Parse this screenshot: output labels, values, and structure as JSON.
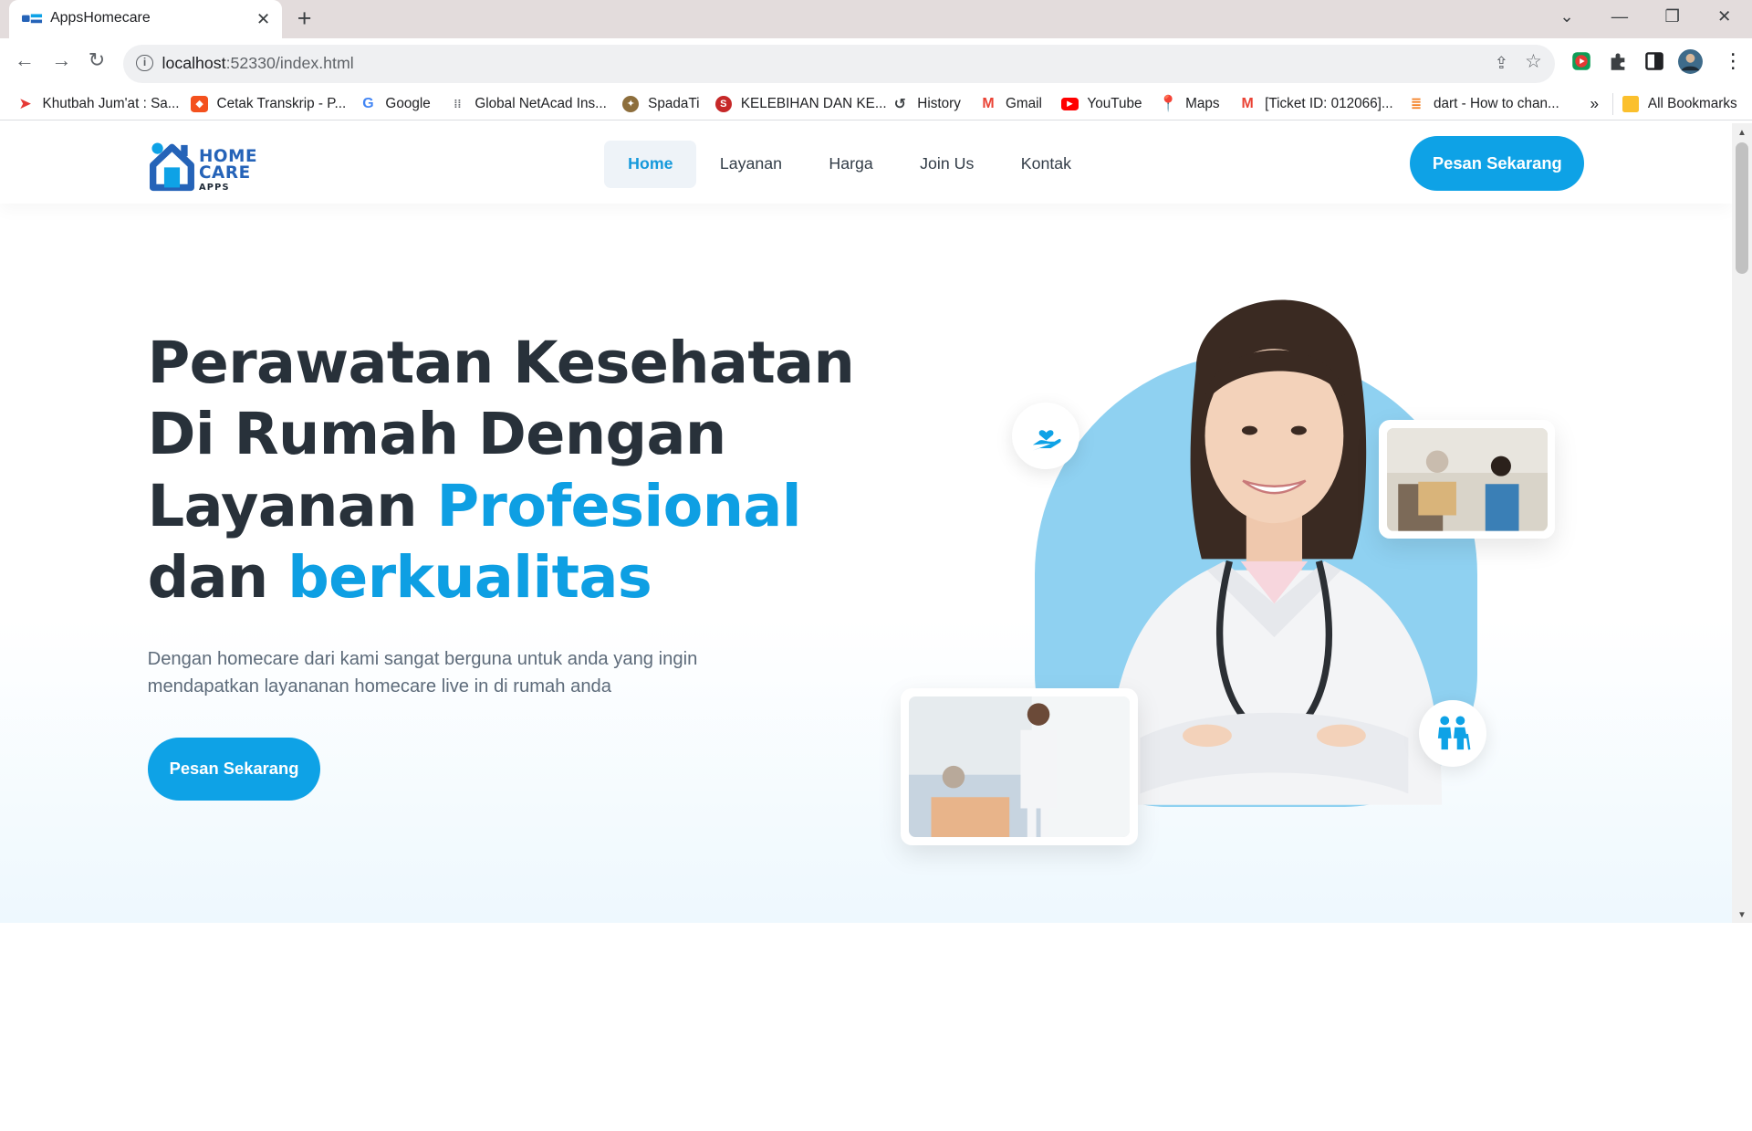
{
  "browser": {
    "tab_title": "AppsHomecare",
    "url_host": "localhost",
    "url_rest": ":52330/index.html",
    "bookmarks": [
      {
        "label": "Khutbah Jum'at : Sa...",
        "icon": "paper-plane-icon",
        "color": "#e53935"
      },
      {
        "label": "Cetak Transkrip - P...",
        "icon": "orange-app-icon",
        "color": "#f4511e"
      },
      {
        "label": "Google",
        "icon": "google-icon",
        "color": "#4285f4"
      },
      {
        "label": "Global NetAcad Ins...",
        "icon": "cisco-icon",
        "color": "#5f6368"
      },
      {
        "label": "SpadaTi",
        "icon": "spadati-icon",
        "color": "#8d6e3c"
      },
      {
        "label": "KELEBIHAN DAN KE...",
        "icon": "s-logo-icon",
        "color": "#c62828"
      },
      {
        "label": "History",
        "icon": "history-icon",
        "color": "#3c4043"
      },
      {
        "label": "Gmail",
        "icon": "gmail-icon",
        "color": "#ea4335"
      },
      {
        "label": "YouTube",
        "icon": "youtube-icon",
        "color": "#ff0000"
      },
      {
        "label": "Maps",
        "icon": "maps-icon",
        "color": "#34a853"
      },
      {
        "label": "[Ticket ID: 012066]...",
        "icon": "gmail-icon",
        "color": "#ea4335"
      },
      {
        "label": "dart - How to chan...",
        "icon": "stackoverflow-icon",
        "color": "#f48024"
      }
    ],
    "more_bookmarks": "»",
    "all_bookmarks": "All Bookmarks"
  },
  "site": {
    "logo": {
      "line1": "HOME",
      "line2": "CARE",
      "line3": "APPS"
    },
    "menu": [
      {
        "label": "Home",
        "active": true
      },
      {
        "label": "Layanan",
        "active": false
      },
      {
        "label": "Harga",
        "active": false
      },
      {
        "label": "Join Us",
        "active": false
      },
      {
        "label": "Kontak",
        "active": false
      }
    ],
    "cta_label": "Pesan Sekarang"
  },
  "hero": {
    "title_line1": "Perawatan Kesehatan",
    "title_line2": "Di Rumah Dengan",
    "title_line3a": "Layanan ",
    "title_line3b": "Profesional",
    "title_line4a": "dan ",
    "title_line4b": "berkualitas",
    "description": "Dengan homecare dari kami sangat berguna untuk anda yang ingin mendapatkan layananan homecare live in di rumah anda",
    "button_label": "Pesan Sekarang"
  },
  "colors": {
    "accent": "#0ea2e6",
    "heading": "#28313a",
    "blob": "#8fd1f1"
  }
}
